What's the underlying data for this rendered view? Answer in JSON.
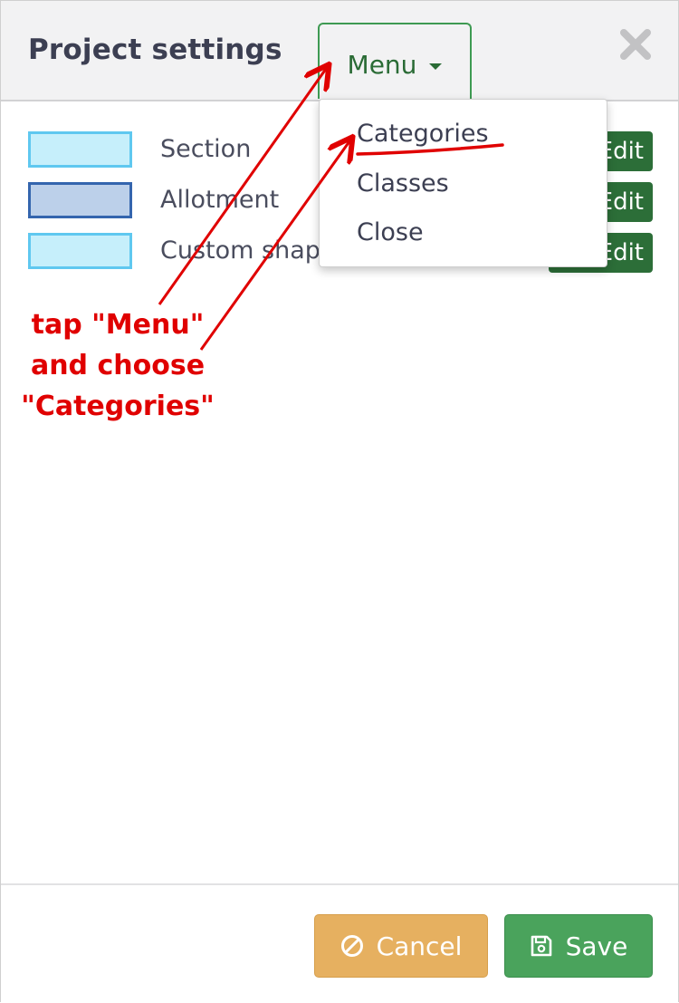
{
  "header": {
    "title": "Project settings",
    "menu_label": "Menu"
  },
  "rows": [
    {
      "label": "Section",
      "edit_label": "Edit",
      "swatch_fill": "#c6effb",
      "swatch_border": "#5fc8f0"
    },
    {
      "label": "Allotment",
      "edit_label": "Edit",
      "swatch_fill": "#bcd0ea",
      "swatch_border": "#3465ae"
    },
    {
      "label": "Custom shape",
      "edit_label": "Edit",
      "swatch_fill": "#c6effb",
      "swatch_border": "#5fc8f0"
    }
  ],
  "dropdown": {
    "items": [
      {
        "label": "Categories"
      },
      {
        "label": "Classes"
      },
      {
        "label": "Close"
      }
    ]
  },
  "footer": {
    "cancel_label": "Cancel",
    "save_label": "Save"
  },
  "annotation": {
    "line1": "tap \"Menu\"",
    "line2": "and choose",
    "line3": "\"Categories\""
  },
  "icons": {
    "close": "close-icon",
    "caret": "caret-down-icon",
    "cancel": "ban-icon",
    "save": "floppy-disk-icon"
  },
  "colors": {
    "accent_green": "#2c6e38",
    "save_green": "#4aa35c",
    "cancel_orange": "#e6b060",
    "annotation_red": "#e00000"
  }
}
